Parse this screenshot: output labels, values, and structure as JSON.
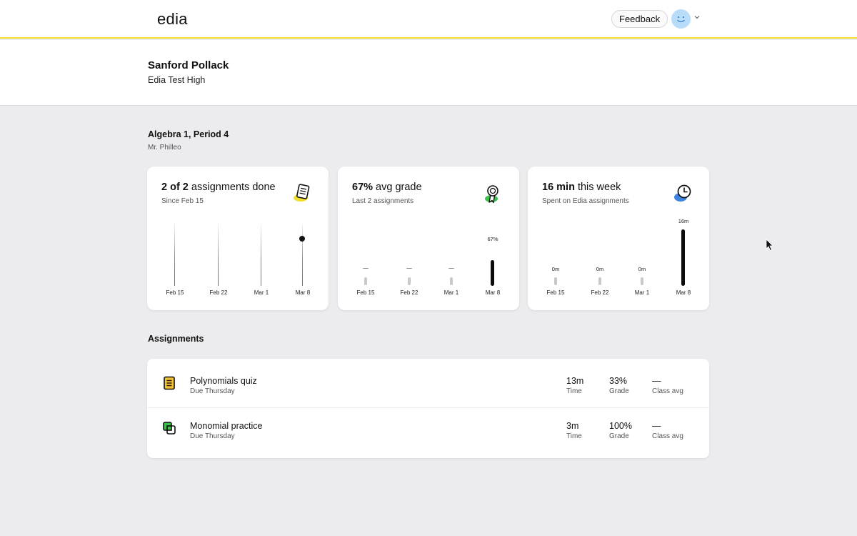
{
  "header": {
    "logo": "edia",
    "feedback_label": "Feedback"
  },
  "student": {
    "name": "Sanford Pollack",
    "school": "Edia Test High"
  },
  "class": {
    "title": "Algebra 1, Period 4",
    "teacher": "Mr. Philleo"
  },
  "cards": [
    {
      "headline_bold": "2 of 2",
      "headline_rest": " assignments done",
      "sub": "Since Feb 15",
      "icon": "assignment-icon",
      "chart_data": {
        "type": "scatter",
        "categories": [
          "Feb 15",
          "Feb 22",
          "Mar 1",
          "Mar 8"
        ],
        "completed": [
          null,
          null,
          null,
          2
        ]
      }
    },
    {
      "headline_bold": "67%",
      "headline_rest": " avg grade",
      "sub": "Last 2 assignments",
      "icon": "award-ribbon-icon",
      "chart_data": {
        "type": "bar",
        "categories": [
          "Feb 15",
          "Feb 22",
          "Mar 1",
          "Mar 8"
        ],
        "values": [
          null,
          null,
          null,
          67
        ],
        "labels": [
          "—",
          "—",
          "—",
          "67%"
        ],
        "ylim": [
          0,
          100
        ]
      }
    },
    {
      "headline_bold": "16 min",
      "headline_rest": " this week",
      "sub": "Spent on Edia assignments",
      "icon": "clock-icon",
      "chart_data": {
        "type": "bar",
        "categories": [
          "Feb 15",
          "Feb 22",
          "Mar 1",
          "Mar 8"
        ],
        "values": [
          0,
          0,
          0,
          16
        ],
        "labels": [
          "0m",
          "0m",
          "0m",
          "16m"
        ],
        "ylim": [
          0,
          16
        ]
      }
    }
  ],
  "assignments_title": "Assignments",
  "assignments": [
    {
      "title": "Polynomials quiz",
      "due": "Due Thursday",
      "icon": "quiz-icon",
      "time": "13m",
      "time_label": "Time",
      "grade": "33%",
      "grade_label": "Grade",
      "class_avg": "—",
      "class_avg_label": "Class avg"
    },
    {
      "title": "Monomial practice",
      "due": "Due Thursday",
      "icon": "practice-icon",
      "time": "3m",
      "time_label": "Time",
      "grade": "100%",
      "grade_label": "Grade",
      "class_avg": "—",
      "class_avg_label": "Class avg"
    }
  ],
  "colors": {
    "accent_yellow": "#f1de2f",
    "background": "#ecebee",
    "avatar_blue": "#b9ddf9",
    "green": "#3cc24a",
    "blue": "#3d84e0"
  }
}
